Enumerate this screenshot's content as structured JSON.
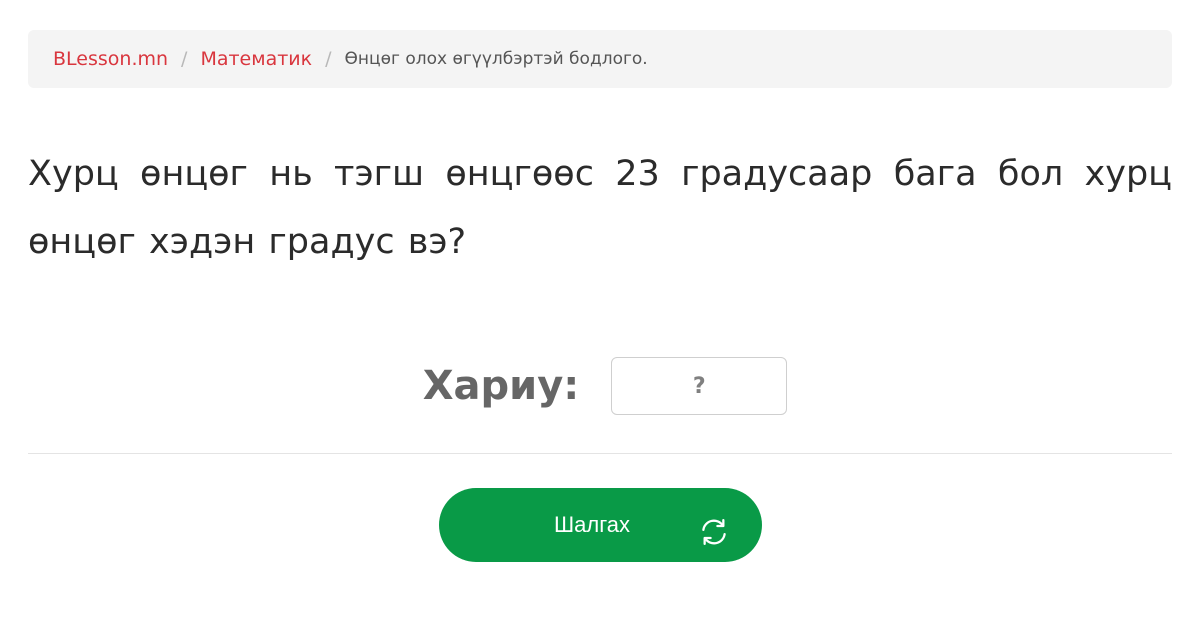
{
  "breadcrumb": {
    "home": "BLesson.mn",
    "category": "Математик",
    "current": "Өнцөг олох өгүүлбэртэй бодлого.",
    "separator": "/"
  },
  "question": {
    "text": "Хурц өнцөг нь тэгш өнцгөөс 23 градусаар бага бол хурц өнцөг хэдэн градус вэ?"
  },
  "answer": {
    "label": "Хариу:",
    "placeholder": "?",
    "value": ""
  },
  "check_button": {
    "label": "Шалгах",
    "icon": "refresh-icon"
  },
  "colors": {
    "link": "#d9363e",
    "button": "#099a47",
    "breadcrumb_bg": "#f4f4f4"
  }
}
